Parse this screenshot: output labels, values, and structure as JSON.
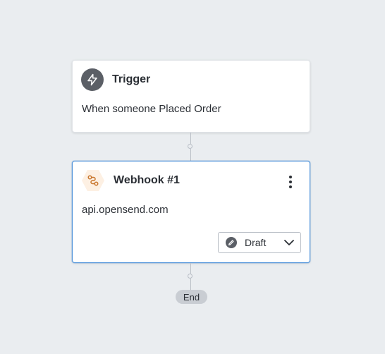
{
  "colors": {
    "canvas_bg": "#eaedf0",
    "selected_border": "#4a90d9",
    "webhook_icon": "#c9772e",
    "webhook_icon_bg": "#fdf0e3"
  },
  "trigger": {
    "title": "Trigger",
    "description": "When someone Placed Order",
    "icon": "lightning-bolt-icon"
  },
  "webhook": {
    "title": "Webhook #1",
    "url": "api.opensend.com",
    "icon": "webhook-icon",
    "status": {
      "label": "Draft",
      "icon": "pencil-icon"
    }
  },
  "end": {
    "label": "End"
  }
}
